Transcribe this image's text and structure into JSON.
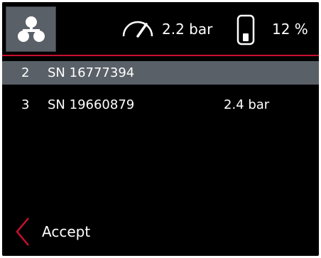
{
  "header": {
    "menu_icon": "network-nodes-icon",
    "pressure_icon": "gauge-icon",
    "pressure": "2.2 bar",
    "battery_icon": "battery-icon",
    "battery_level_text": "12 %",
    "battery_level": 0.12,
    "accent_color": "#c8102e"
  },
  "list": {
    "items": [
      {
        "index": "2",
        "serial": "SN 16777394",
        "value": "",
        "selected": true
      },
      {
        "index": "3",
        "serial": "SN 19660879",
        "value": "2.4  bar",
        "selected": false
      }
    ]
  },
  "footer": {
    "back_icon": "chevron-left-icon",
    "accept_label": "Accept"
  }
}
